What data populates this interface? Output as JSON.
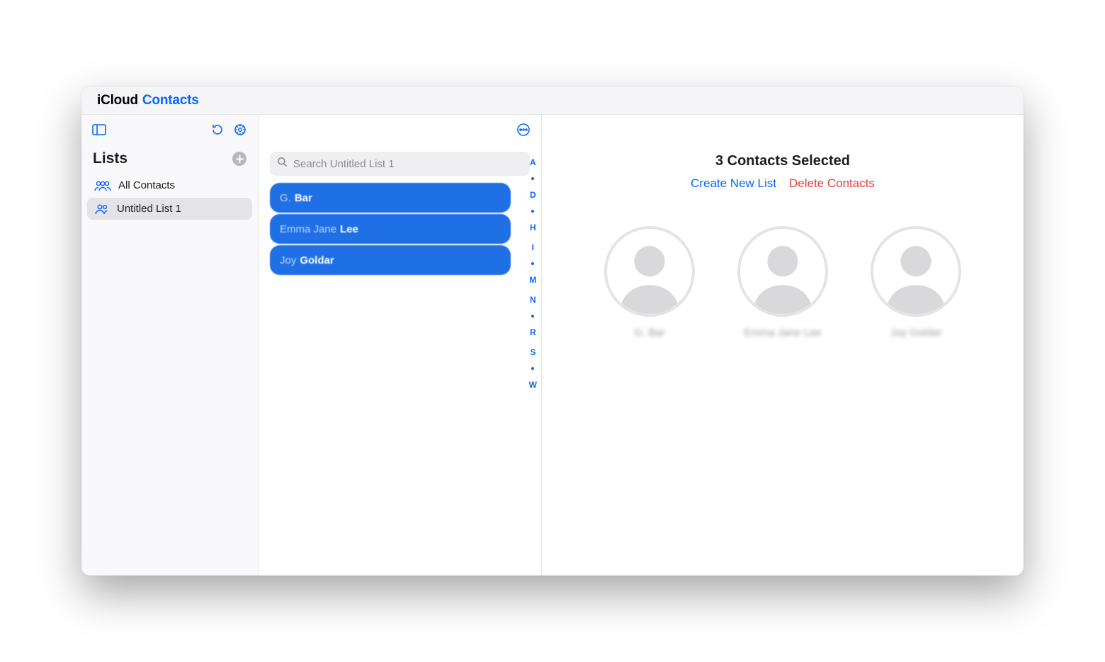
{
  "header": {
    "brand": "iCloud",
    "app": "Contacts"
  },
  "sidebar": {
    "title": "Lists",
    "items": [
      {
        "label": "All Contacts",
        "icon": "people3",
        "selected": false
      },
      {
        "label": "Untitled List 1",
        "icon": "people2",
        "selected": true
      }
    ]
  },
  "search": {
    "placeholder": "Search Untitled List 1"
  },
  "contacts": [
    {
      "first": "G.",
      "last": "Bar"
    },
    {
      "first": "Emma Jane",
      "last": "Lee"
    },
    {
      "first": "Joy",
      "last": "Goldar"
    }
  ],
  "alpha_index": [
    "A",
    "•",
    "D",
    "•",
    "H",
    "I",
    "•",
    "M",
    "N",
    "•",
    "R",
    "S",
    "•",
    "W"
  ],
  "detail": {
    "title": "3 Contacts Selected",
    "create_list": "Create New List",
    "delete": "Delete Contacts",
    "selected": [
      {
        "name": "G. Bar"
      },
      {
        "name": "Emma Jane Lee"
      },
      {
        "name": "Joy Goldar"
      }
    ]
  }
}
